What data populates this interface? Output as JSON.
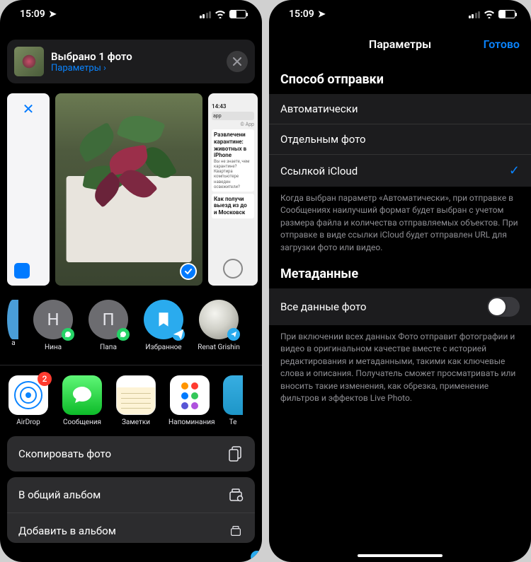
{
  "status": {
    "time": "15:09"
  },
  "left": {
    "header": {
      "title": "Выбрано 1 фото",
      "options_link": "Параметры ›"
    },
    "photo3": {
      "time": "14:43",
      "url": "app",
      "tag": "© Арр",
      "h1": "Развлечени",
      "h1b": "карантине:",
      "h1c": "животных в",
      "h1d": "iPhone",
      "p1": "Вы не знаете, чем",
      "p1b": "карантине? Квартира",
      "p1c": "компьютере наведен",
      "p1d": "освежители?",
      "h2": "Как получи",
      "h2b": "выезд из до",
      "h2c": "и Московск"
    },
    "contacts": [
      {
        "initial": "",
        "name": "а"
      },
      {
        "initial": "Н",
        "name": "Нина"
      },
      {
        "initial": "П",
        "name": "Папа"
      },
      {
        "initial": "",
        "name": "Избранное"
      },
      {
        "initial": "",
        "name": "Renat Grishin"
      }
    ],
    "apps": [
      {
        "name": "AirDrop",
        "badge": "2"
      },
      {
        "name": "Сообщения"
      },
      {
        "name": "Заметки"
      },
      {
        "name": "Напоминания"
      },
      {
        "name": "Те"
      }
    ],
    "actions": {
      "a1": "Скопировать фото",
      "a2": "В общий альбом",
      "a3": "Добавить в альбом"
    }
  },
  "right": {
    "nav": {
      "title": "Параметры",
      "done": "Готово"
    },
    "s1": {
      "title": "Способ отправки",
      "o1": "Автоматически",
      "o2": "Отдельным фото",
      "o3": "Ссылкой iCloud",
      "desc": "Когда выбран параметр «Автоматически», при отправке в Сообщениях наилучший формат будет выбран с учетом размера файла и количества отправляемых объектов. При отправке в виде ссылки iCloud будет отправлен URL для загрузки фото или видео."
    },
    "s2": {
      "title": "Метаданные",
      "o1": "Все данные фото",
      "desc": "При включении всех данных Фото отправит фотографии и видео в оригинальном качестве вместе с историей редактирования и метаданными, такими как ключевые слова и описания. Получатель сможет просматривать или вносить такие изменения, как обрезка, применение фильтров и эффектов Live Photo."
    }
  }
}
